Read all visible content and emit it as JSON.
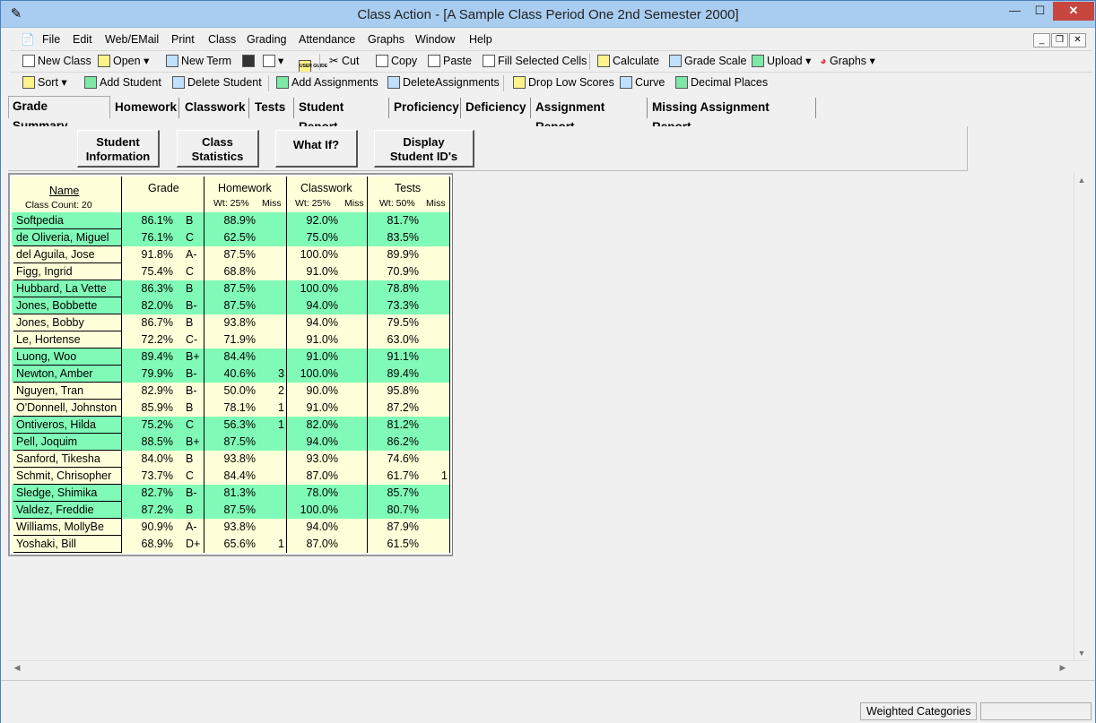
{
  "window": {
    "title": "Class Action - [A Sample Class Period One 2nd Semester 2000]",
    "min": "—",
    "max": "☐",
    "close": "✕",
    "mdi_min": "_",
    "mdi_restore": "❐",
    "mdi_close": "✕"
  },
  "menu": [
    "File",
    "Edit",
    "Web/EMail",
    "Print",
    "Class",
    "Grading",
    "Attendance",
    "Graphs",
    "Window",
    "Help"
  ],
  "toolbar1": {
    "new_class": "New Class",
    "open": "Open",
    "new_term": "New Term",
    "cut": "Cut",
    "copy": "Copy",
    "paste": "Paste",
    "fill_selected": "Fill Selected Cells",
    "calculate": "Calculate",
    "grade_scale": "Grade Scale",
    "upload": "Upload",
    "graphs": "Graphs",
    "user_guide_icon": "USER GUIDE"
  },
  "toolbar2": {
    "sort": "Sort",
    "add_student": "Add Student",
    "delete_student": "Delete Student",
    "add_assignments": "Add Assignments",
    "delete_assignments": "DeleteAssignments",
    "drop_low": "Drop Low Scores",
    "curve": "Curve",
    "decimal_places": "Decimal Places"
  },
  "tabs": [
    "Grade Summary",
    "Homework",
    "Classwork",
    "Tests",
    "Student Report",
    "Proficiency",
    "Deficiency",
    "Assignment Report",
    "Missing Assignment Report"
  ],
  "actions": {
    "student_info_1": "Student",
    "student_info_2": "Information",
    "class_stats_1": "Class",
    "class_stats_2": "Statistics",
    "what_if": "What If?",
    "display_ids_1": "Display",
    "display_ids_2": "Student ID's"
  },
  "grid": {
    "name_header": "Name",
    "class_count": "Class Count: 20",
    "grade_header": "Grade",
    "homework_header": "Homework",
    "homework_wt": "Wt: 25%",
    "classwork_header": "Classwork",
    "classwork_wt": "Wt: 25%",
    "tests_header": "Tests",
    "tests_wt": "Wt: 50%",
    "miss": "Miss",
    "rows": [
      {
        "name": "Softpedia",
        "pct": "86.1%",
        "letter": "B",
        "hw": "88.9%",
        "hw_miss": "",
        "cw": "92.0%",
        "cw_miss": "",
        "t": "81.7%",
        "t_miss": "",
        "hl": true
      },
      {
        "name": "de Oliveria, Miguel",
        "pct": "76.1%",
        "letter": "C",
        "hw": "62.5%",
        "hw_miss": "",
        "cw": "75.0%",
        "cw_miss": "",
        "t": "83.5%",
        "t_miss": "",
        "hl": true
      },
      {
        "name": "del Aguila, Jose",
        "pct": "91.8%",
        "letter": "A-",
        "hw": "87.5%",
        "hw_miss": "",
        "cw": "100.0%",
        "cw_miss": "",
        "t": "89.9%",
        "t_miss": "",
        "hl": false
      },
      {
        "name": "Figg, Ingrid",
        "pct": "75.4%",
        "letter": "C",
        "hw": "68.8%",
        "hw_miss": "",
        "cw": "91.0%",
        "cw_miss": "",
        "t": "70.9%",
        "t_miss": "",
        "hl": false
      },
      {
        "name": "Hubbard, La Vette",
        "pct": "86.3%",
        "letter": "B",
        "hw": "87.5%",
        "hw_miss": "",
        "cw": "100.0%",
        "cw_miss": "",
        "t": "78.8%",
        "t_miss": "",
        "hl": true
      },
      {
        "name": "Jones, Bobbette",
        "pct": "82.0%",
        "letter": "B-",
        "hw": "87.5%",
        "hw_miss": "",
        "cw": "94.0%",
        "cw_miss": "",
        "t": "73.3%",
        "t_miss": "",
        "hl": true
      },
      {
        "name": "Jones, Bobby",
        "pct": "86.7%",
        "letter": "B",
        "hw": "93.8%",
        "hw_miss": "",
        "cw": "94.0%",
        "cw_miss": "",
        "t": "79.5%",
        "t_miss": "",
        "hl": false
      },
      {
        "name": "Le, Hortense",
        "pct": "72.2%",
        "letter": "C-",
        "hw": "71.9%",
        "hw_miss": "",
        "cw": "91.0%",
        "cw_miss": "",
        "t": "63.0%",
        "t_miss": "",
        "hl": false
      },
      {
        "name": "Luong, Woo",
        "pct": "89.4%",
        "letter": "B+",
        "hw": "84.4%",
        "hw_miss": "",
        "cw": "91.0%",
        "cw_miss": "",
        "t": "91.1%",
        "t_miss": "",
        "hl": true
      },
      {
        "name": "Newton, Amber",
        "pct": "79.9%",
        "letter": "B-",
        "hw": "40.6%",
        "hw_miss": "3",
        "cw": "100.0%",
        "cw_miss": "",
        "t": "89.4%",
        "t_miss": "",
        "hl": true
      },
      {
        "name": "Nguyen, Tran",
        "pct": "82.9%",
        "letter": "B-",
        "hw": "50.0%",
        "hw_miss": "2",
        "cw": "90.0%",
        "cw_miss": "",
        "t": "95.8%",
        "t_miss": "",
        "hl": false
      },
      {
        "name": "O'Donnell, Johnston",
        "pct": "85.9%",
        "letter": "B",
        "hw": "78.1%",
        "hw_miss": "1",
        "cw": "91.0%",
        "cw_miss": "",
        "t": "87.2%",
        "t_miss": "",
        "hl": false
      },
      {
        "name": "Ontiveros, Hilda",
        "pct": "75.2%",
        "letter": "C",
        "hw": "56.3%",
        "hw_miss": "1",
        "cw": "82.0%",
        "cw_miss": "",
        "t": "81.2%",
        "t_miss": "",
        "hl": true
      },
      {
        "name": "Pell, Joquim",
        "pct": "88.5%",
        "letter": "B+",
        "hw": "87.5%",
        "hw_miss": "",
        "cw": "94.0%",
        "cw_miss": "",
        "t": "86.2%",
        "t_miss": "",
        "hl": true
      },
      {
        "name": "Sanford, Tikesha",
        "pct": "84.0%",
        "letter": "B",
        "hw": "93.8%",
        "hw_miss": "",
        "cw": "93.0%",
        "cw_miss": "",
        "t": "74.6%",
        "t_miss": "",
        "hl": false
      },
      {
        "name": "Schmit, Chrisopher",
        "pct": "73.7%",
        "letter": "C",
        "hw": "84.4%",
        "hw_miss": "",
        "cw": "87.0%",
        "cw_miss": "",
        "t": "61.7%",
        "t_miss": "1",
        "hl": false
      },
      {
        "name": "Sledge, Shimika",
        "pct": "82.7%",
        "letter": "B-",
        "hw": "81.3%",
        "hw_miss": "",
        "cw": "78.0%",
        "cw_miss": "",
        "t": "85.7%",
        "t_miss": "",
        "hl": true
      },
      {
        "name": "Valdez, Freddie",
        "pct": "87.2%",
        "letter": "B",
        "hw": "87.5%",
        "hw_miss": "",
        "cw": "100.0%",
        "cw_miss": "",
        "t": "80.7%",
        "t_miss": "",
        "hl": true
      },
      {
        "name": "Williams, MollyBe",
        "pct": "90.9%",
        "letter": "A-",
        "hw": "93.8%",
        "hw_miss": "",
        "cw": "94.0%",
        "cw_miss": "",
        "t": "87.9%",
        "t_miss": "",
        "hl": false
      },
      {
        "name": "Yoshaki, Bill",
        "pct": "68.9%",
        "letter": "D+",
        "hw": "65.6%",
        "hw_miss": "1",
        "cw": "87.0%",
        "cw_miss": "",
        "t": "61.5%",
        "t_miss": "",
        "hl": false
      }
    ]
  },
  "status": {
    "weighted": "Weighted Categories"
  },
  "colors": {
    "highlight_row": "#80fab7",
    "normal_row": "#ffffd9"
  }
}
